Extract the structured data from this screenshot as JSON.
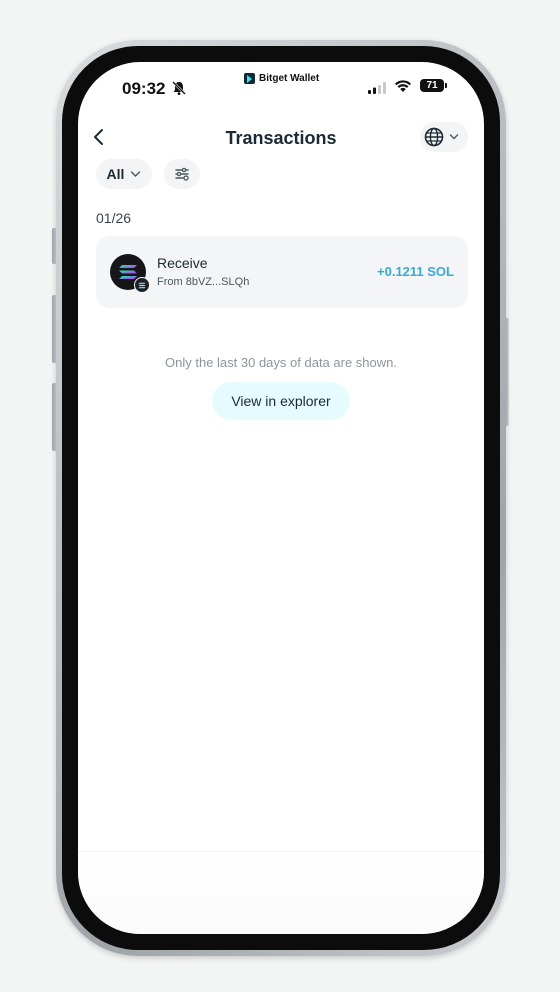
{
  "status_bar": {
    "time": "09:32",
    "brand": "Bitget Wallet",
    "battery": "71"
  },
  "header": {
    "title": "Transactions",
    "network_icon": "globe-icon"
  },
  "filters": {
    "type_label": "All"
  },
  "transactions": {
    "date": "01/26",
    "items": [
      {
        "type": "Receive",
        "from": "From 8bVZ...SLQh",
        "amount": "+0.1211 SOL",
        "icon": "solana-icon"
      }
    ]
  },
  "notice": "Only the last 30 days of data are shown.",
  "explorer_button": "View in explorer",
  "colors": {
    "accent_amount": "#39aacf",
    "explorer_bg": "#e6fbfd"
  }
}
